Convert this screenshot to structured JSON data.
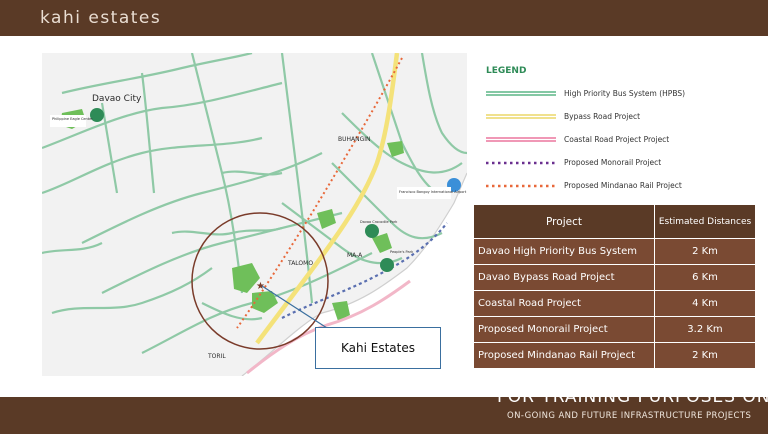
{
  "header": {
    "brand": "kahi estates"
  },
  "map": {
    "labels": {
      "davao_city": "Davao City",
      "buhangin": "BUHANGIN",
      "talomo": "TALOMO",
      "matina": "MA-A",
      "toril": "TORIL",
      "eagle_center": "Philippine Eagle Center",
      "airport": "Francisco Bangoy International Airport",
      "crocodile_park": "Davao Crocodile Park",
      "peoples_park": "People's Park"
    },
    "callout": "Kahi Estates"
  },
  "legend": {
    "title": "LEGEND",
    "items": [
      {
        "label": "High Priority Bus System (HPBS)",
        "color": "#3aa76d",
        "style": "double"
      },
      {
        "label": "Bypass Road Project",
        "color": "#f4e27a",
        "style": "double"
      },
      {
        "label": "Coastal Road Project Project",
        "color": "#e85a8a",
        "style": "double"
      },
      {
        "label": "Proposed Monorail Project",
        "color": "#6a2f8f",
        "style": "dotted"
      },
      {
        "label": "Proposed Mindanao Rail Project",
        "color": "#e8683a",
        "style": "dotted"
      }
    ]
  },
  "distances": {
    "headers": [
      "Project",
      "Estimated Distances"
    ],
    "rows": [
      [
        "Davao High Priority Bus System",
        "2 Km"
      ],
      [
        "Davao Bypass Road Project",
        "6 Km"
      ],
      [
        "Coastal Road Project",
        "4 Km"
      ],
      [
        "Proposed Monorail Project",
        "3.2 Km"
      ],
      [
        "Proposed Mindanao Rail Project",
        "2 Km"
      ]
    ]
  },
  "footer": {
    "watermark": "FOR TRAINING PURPOSES ONLY",
    "caption": "ON-GOING AND FUTURE INFRASTRUCTURE PROJECTS"
  },
  "colors": {
    "brand_brown": "#5a3a26",
    "row_brown": "#7a4a33",
    "road_green": "#8fc9a6",
    "bypass_yellow": "#f4e27a",
    "sea": "#ffffff"
  }
}
